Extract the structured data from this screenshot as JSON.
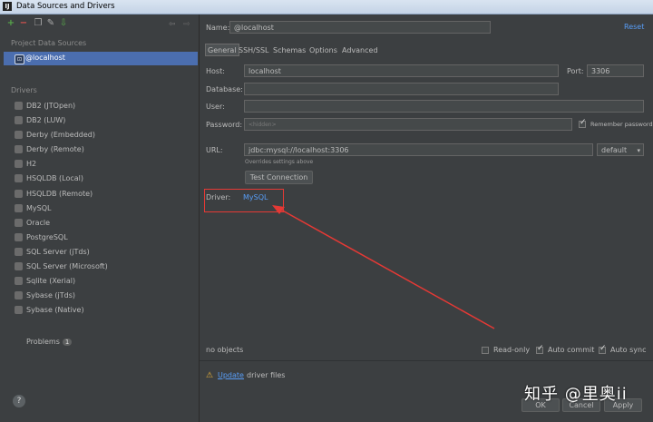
{
  "window": {
    "title": "Data Sources and Drivers"
  },
  "left": {
    "project_label": "Project Data Sources",
    "selected_source": "@localhost",
    "drivers_label": "Drivers",
    "drivers": [
      {
        "label": "DB2 (JTOpen)",
        "icon": "db2-icon"
      },
      {
        "label": "DB2 (LUW)",
        "icon": "db2-icon"
      },
      {
        "label": "Derby (Embedded)",
        "icon": "derby-icon"
      },
      {
        "label": "Derby (Remote)",
        "icon": "derby-icon"
      },
      {
        "label": "H2",
        "icon": "h2-icon"
      },
      {
        "label": "HSQLDB (Local)",
        "icon": "hsqldb-icon"
      },
      {
        "label": "HSQLDB (Remote)",
        "icon": "hsqldb-icon"
      },
      {
        "label": "MySQL",
        "icon": "mysql-icon"
      },
      {
        "label": "Oracle",
        "icon": "oracle-icon"
      },
      {
        "label": "PostgreSQL",
        "icon": "postgresql-icon"
      },
      {
        "label": "SQL Server (jTds)",
        "icon": "sqlserver-icon"
      },
      {
        "label": "SQL Server (Microsoft)",
        "icon": "sqlserver-icon"
      },
      {
        "label": "Sqlite (Xerial)",
        "icon": "sqlite-icon"
      },
      {
        "label": "Sybase (jTds)",
        "icon": "sybase-icon"
      },
      {
        "label": "Sybase (Native)",
        "icon": "sybase-icon"
      }
    ],
    "problems_label": "Problems",
    "problems_count": "1",
    "help": "?"
  },
  "right": {
    "name_label": "Name:",
    "name_value": "@localhost",
    "reset": "Reset",
    "tabs": [
      "General",
      "SSH/SSL",
      "Schemas",
      "Options",
      "Advanced"
    ],
    "host_label": "Host:",
    "host_value": "localhost",
    "port_label": "Port:",
    "port_value": "3306",
    "database_label": "Database:",
    "user_label": "User:",
    "password_label": "Password:",
    "password_placeholder": "<hidden>",
    "remember_password": "Remember password",
    "url_label": "URL:",
    "url_value": "jdbc:mysql://localhost:3306",
    "url_mode": "default",
    "overrides_note": "Overrides settings above",
    "test_connection": "Test Connection",
    "driver_label": "Driver:",
    "driver_value": "MySQL",
    "no_objects": "no objects",
    "read_only": "Read-only",
    "auto_commit": "Auto commit",
    "auto_sync": "Auto sync",
    "update_link": "Update",
    "update_text": "driver files",
    "ok": "OK",
    "cancel": "Cancel",
    "apply": "Apply"
  },
  "watermark": "知乎 @里奥ii",
  "colors": {
    "accent": "#4b6eaf",
    "link": "#589df6",
    "annotation": "#e53935",
    "background": "#3c3f41"
  }
}
